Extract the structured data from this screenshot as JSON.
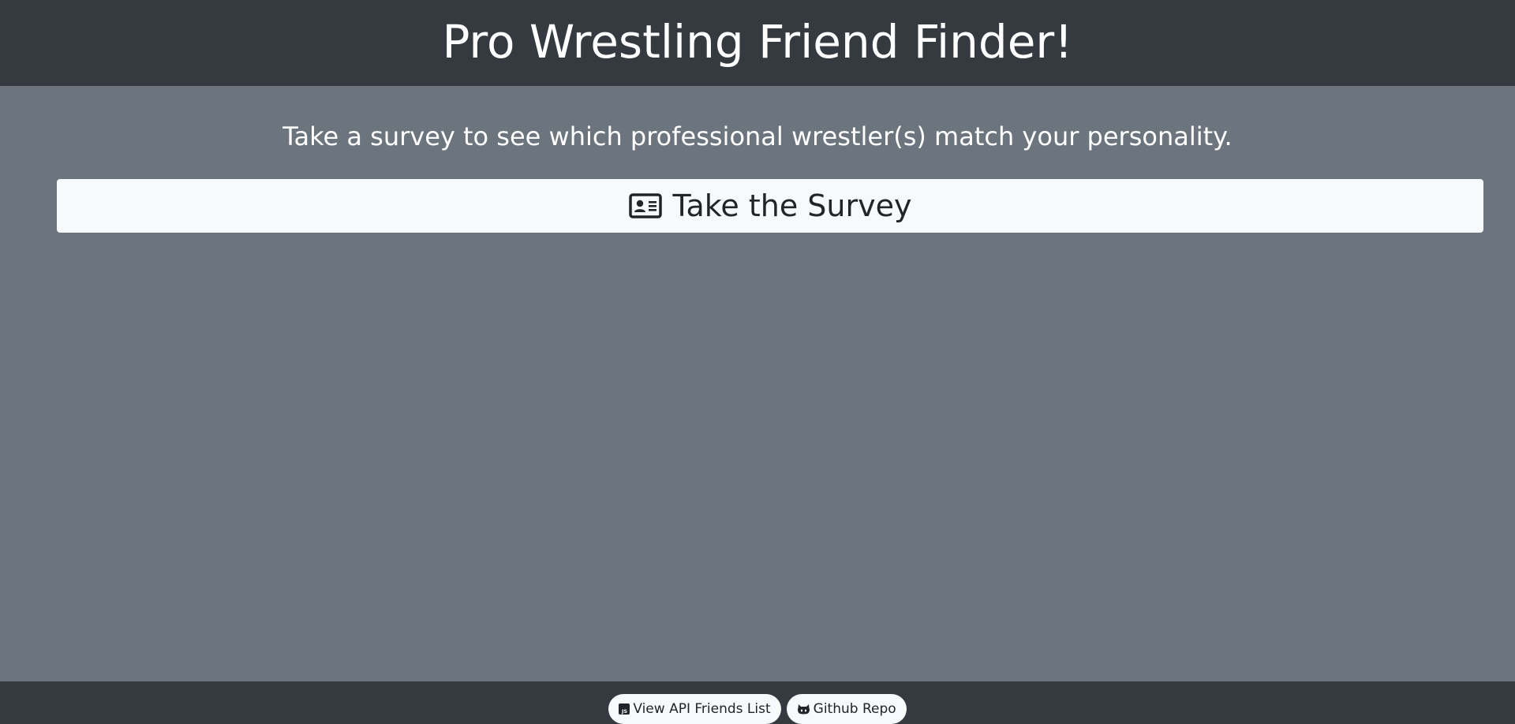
{
  "header": {
    "title": "Pro Wrestling Friend Finder!"
  },
  "main": {
    "subtitle": "Take a survey to see which professional wrestler(s) match your personality.",
    "survey_button": {
      "label": "Take the Survey",
      "icon": "id-card-icon"
    }
  },
  "footer": {
    "links": [
      {
        "label": "View API Friends List",
        "icon": "js-square-icon"
      },
      {
        "label": "Github Repo",
        "icon": "github-icon"
      }
    ]
  },
  "colors": {
    "header_bg": "#343a40",
    "page_bg": "#6c757d",
    "button_bg": "#f8f9fa",
    "text_light": "#ffffff",
    "text_dark": "#212529"
  }
}
